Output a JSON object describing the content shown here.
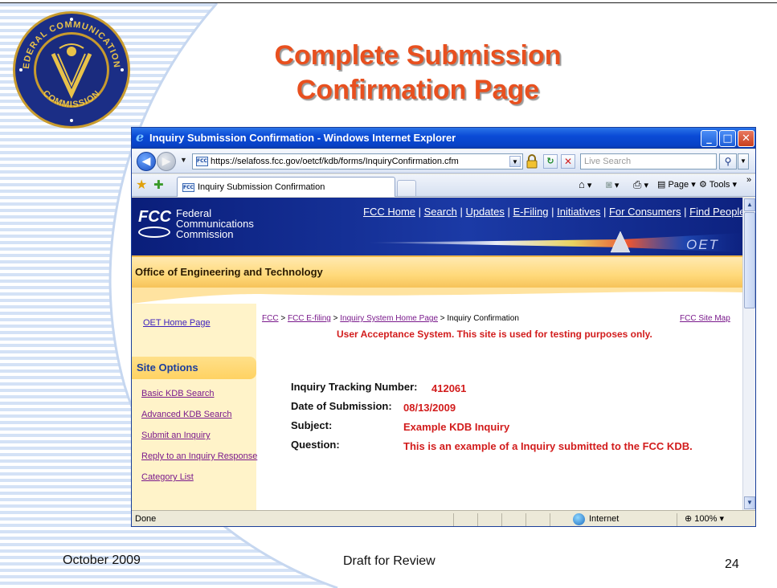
{
  "slide": {
    "title_line1": "Complete Submission",
    "title_line2": "Confirmation Page",
    "footer_date": "October 2009",
    "footer_center": "Draft for Review",
    "page_number": "24",
    "seal_text_top": "FEDERAL COMMUNICATIONS",
    "seal_text_bottom": "COMMISSION"
  },
  "browser": {
    "window_title": "Inquiry Submission Confirmation - Windows Internet Explorer",
    "url": "https://selafoss.fcc.gov/oetcf/kdb/forms/InquiryConfirmation.cfm",
    "search_placeholder": "Live Search",
    "tab_label": "Inquiry Submission Confirmation",
    "cmd_page": "Page",
    "cmd_tools": "Tools",
    "status_text": "Done",
    "zone_text": "Internet",
    "zoom_text": "100%"
  },
  "site": {
    "agency_line1": "Federal",
    "agency_line2": "Communications",
    "agency_line3": "Commission",
    "logo_text": "FCC",
    "nav": [
      "FCC Home",
      "Search",
      "Updates",
      "E-Filing",
      "Initiatives",
      "For Consumers",
      "Find People"
    ],
    "oet_mark": "OET",
    "office_title": "Office of Engineering and Technology",
    "oet_home_link": "OET Home Page",
    "site_options_title": "Site Options",
    "site_options": [
      "Basic KDB Search",
      "Advanced KDB Search",
      "Submit an Inquiry",
      "Reply to an Inquiry Response",
      "Category List"
    ],
    "breadcrumb": [
      "FCC",
      "FCC E-filing",
      "Inquiry System Home Page",
      "Inquiry Confirmation"
    ],
    "site_map_link": "FCC Site Map",
    "uat_notice": "User Acceptance System. This site is used for testing purposes only."
  },
  "confirmation": {
    "tracking_label": "Inquiry Tracking Number:",
    "tracking_value": "412061",
    "date_label": "Date of Submission:",
    "date_value": "08/13/2009",
    "subject_label": "Subject:",
    "subject_value": "Example KDB Inquiry",
    "question_label": "Question:",
    "question_value": "This is an example of a Inquiry submitted to the FCC KDB."
  },
  "colors": {
    "title_orange": "#e8501f",
    "value_red": "#d21c1c",
    "fcc_blue": "#1b3aa6",
    "oet_gold": "#ffd97a"
  }
}
